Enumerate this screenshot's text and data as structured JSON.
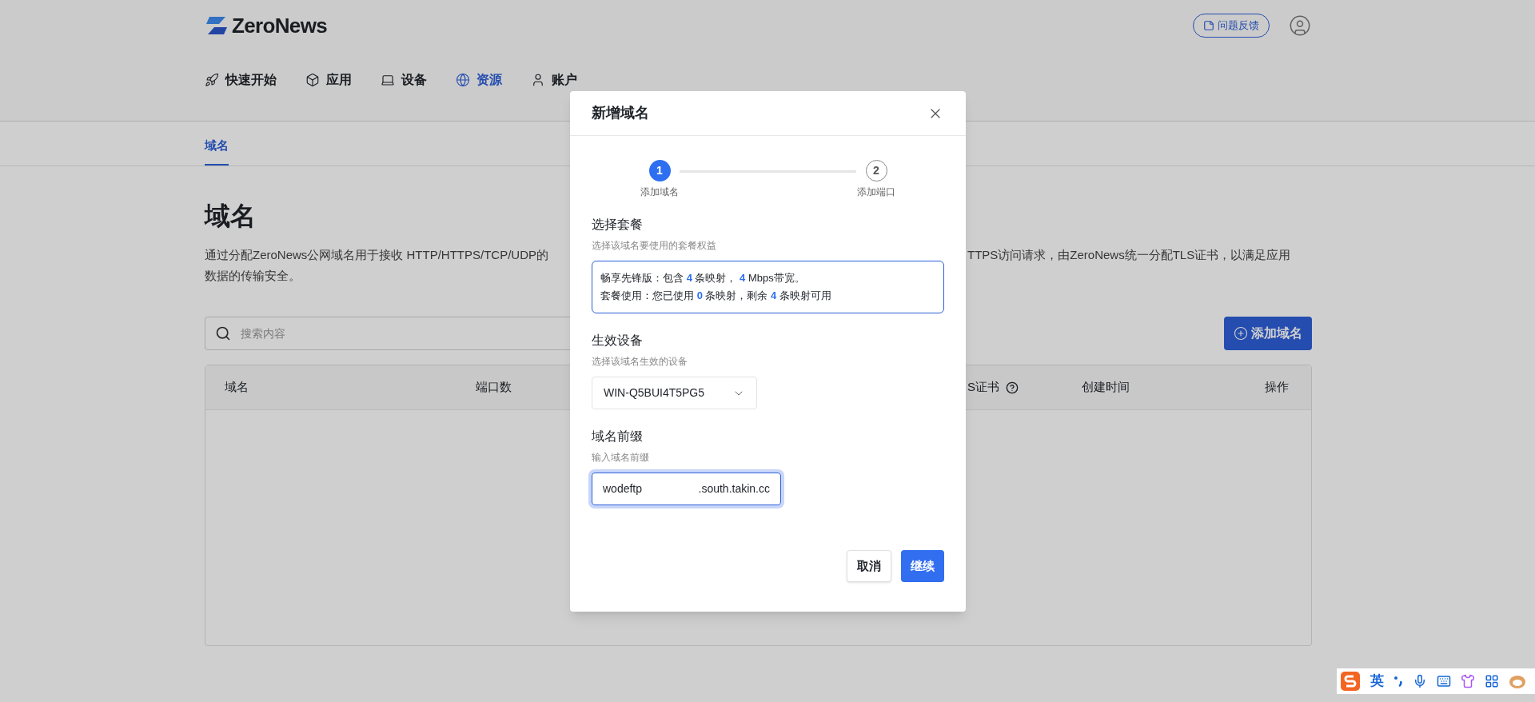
{
  "header": {
    "logo": "ZeroNews",
    "feedback": "问题反馈"
  },
  "nav": [
    {
      "label": "快速开始",
      "selected": false
    },
    {
      "label": "应用",
      "selected": false
    },
    {
      "label": "设备",
      "selected": false
    },
    {
      "label": "资源",
      "selected": true
    },
    {
      "label": "账户",
      "selected": false
    }
  ],
  "tabs": [
    {
      "label": "域名",
      "selected": true
    }
  ],
  "page": {
    "title": "域名",
    "description_left": "通过分配ZeroNews公网域名用于接收 HTTP/HTTPS/TCP/UDP的",
    "description_right": "TTPS访问请求，由ZeroNews统一分配TLS证书，以满足应用",
    "description_line2": "数据的传输安全。",
    "search_placeholder": "搜索内容",
    "add_button": "添加域名"
  },
  "table": {
    "columns": [
      {
        "label": "域名",
        "help": false
      },
      {
        "label": "端口数",
        "help": false
      },
      {
        "label": "S证书",
        "help": true
      },
      {
        "label": "创建时间",
        "help": false
      },
      {
        "label": "操作",
        "help": false
      }
    ]
  },
  "dialog": {
    "title": "新增域名",
    "steps": [
      {
        "number": "1",
        "label": "添加域名",
        "active": true
      },
      {
        "number": "2",
        "label": "添加端口",
        "active": false
      }
    ],
    "plan": {
      "label": "选择套餐",
      "hint": "选择该域名要使用的套餐权益",
      "lines": [
        [
          {
            "kind": "text",
            "text": "畅享先锋版：包含 "
          },
          {
            "kind": "number",
            "text": "4"
          },
          {
            "kind": "text",
            "text": " 条映射， "
          },
          {
            "kind": "number",
            "text": "4"
          },
          {
            "kind": "text",
            "text": " Mbps带宽。"
          }
        ],
        [
          {
            "kind": "text",
            "text": "套餐使用：您已使用 "
          },
          {
            "kind": "number",
            "text": "0"
          },
          {
            "kind": "text",
            "text": " 条映射，剩余 "
          },
          {
            "kind": "number",
            "text": "4"
          },
          {
            "kind": "text",
            "text": " 条映射可用"
          }
        ]
      ]
    },
    "device": {
      "label": "生效设备",
      "hint": "选择该域名生效的设备",
      "value": "WIN-Q5BUI4T5PG5"
    },
    "prefix": {
      "label": "域名前缀",
      "hint": "输入域名前缀",
      "value": "wodeftp",
      "suffix": ".south.takin.cc",
      "focused": true
    },
    "buttons": [
      {
        "label": "取消",
        "kind": "secondary"
      },
      {
        "label": "继续",
        "kind": "primary"
      }
    ]
  },
  "ime_bar": {
    "mode": "英"
  }
}
